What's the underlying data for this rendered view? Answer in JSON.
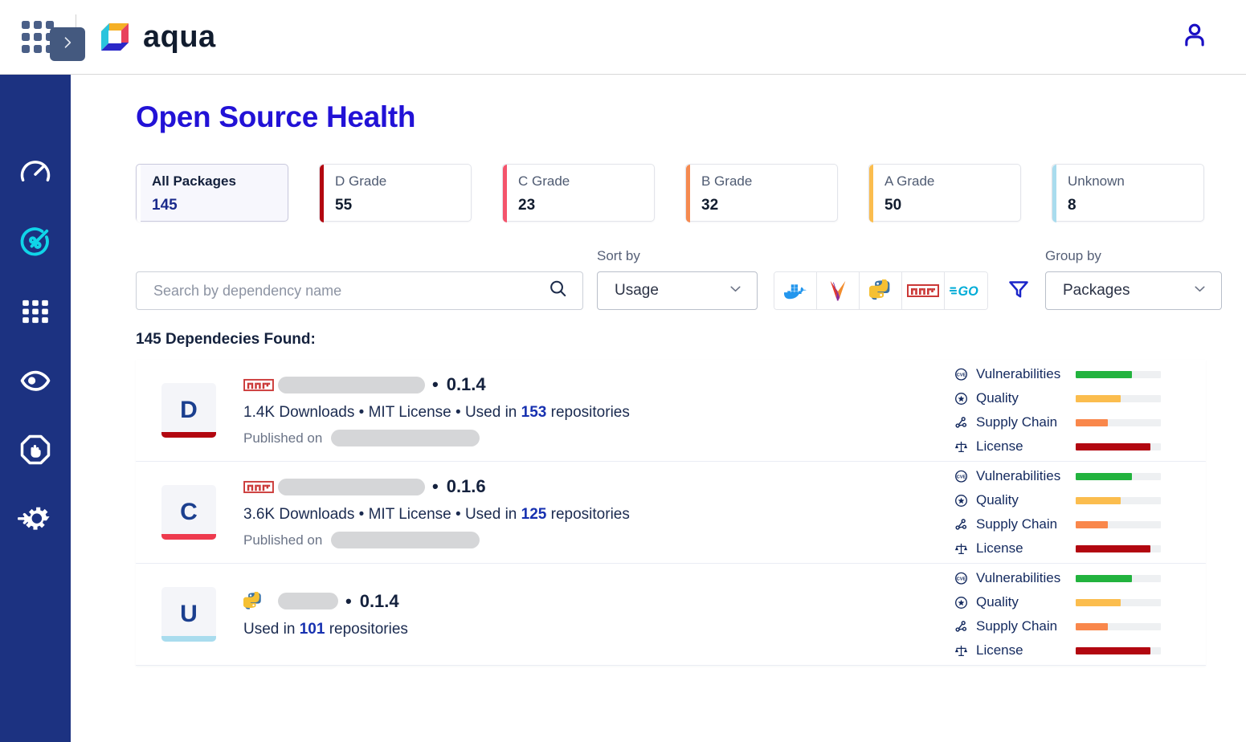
{
  "topbar": {
    "waffle_icon": "apps-grid-icon",
    "brand_name": "aqua",
    "brand_logo_icon": "aqua-logo-icon",
    "user_icon": "user-avatar-icon"
  },
  "sidebar": {
    "toggle_icon": "chevron-right-icon",
    "items": [
      {
        "icon": "dashboard-gauge-icon",
        "active": false
      },
      {
        "icon": "supply-chain-security-icon",
        "active": true
      },
      {
        "icon": "apps-grid-icon",
        "active": false
      },
      {
        "icon": "eye-lens-icon",
        "active": false
      },
      {
        "icon": "stop-hand-octagon-icon",
        "active": false
      },
      {
        "icon": "gear-integration-icon",
        "active": false
      }
    ]
  },
  "page": {
    "title": "Open Source Health"
  },
  "grades": [
    {
      "label": "All Packages",
      "count": "145",
      "accent": "#ffffff",
      "active": true
    },
    {
      "label": "D Grade",
      "count": "55",
      "accent": "#b20710",
      "active": false
    },
    {
      "label": "C Grade",
      "count": "23",
      "accent": "#f4546c",
      "active": false
    },
    {
      "label": "B Grade",
      "count": "32",
      "accent": "#f58a50",
      "active": false
    },
    {
      "label": "A Grade",
      "count": "50",
      "accent": "#fbbd4e",
      "active": false
    },
    {
      "label": "Unknown",
      "count": "8",
      "accent": "#a9dcee",
      "active": false
    }
  ],
  "controls": {
    "search": {
      "placeholder": "Search by dependency name",
      "value": "",
      "icon": "search-icon"
    },
    "sort": {
      "caption": "Sort by",
      "value": "Usage",
      "chevron": "chevron-down-icon"
    },
    "group": {
      "caption": "Group by",
      "value": "Packages",
      "chevron": "chevron-down-icon"
    },
    "tech_filters": [
      {
        "name": "docker-icon",
        "label": "Docker"
      },
      {
        "name": "maven-icon",
        "label": "Maven"
      },
      {
        "name": "python-icon",
        "label": "Python"
      },
      {
        "name": "npm-icon",
        "label": "npm"
      },
      {
        "name": "go-icon",
        "label": "Go"
      }
    ],
    "funnel": {
      "icon": "filter-funnel-icon"
    }
  },
  "list": {
    "found_label": "145 Dependecies Found:",
    "metric_names": [
      "Vulnerabilities",
      "Quality",
      "Supply Chain",
      "License"
    ],
    "metric_icons": [
      "cve-shield-icon",
      "quality-star-icon",
      "supply-chain-nodes-icon",
      "license-scales-icon"
    ],
    "published_label": "Published on",
    "rows": [
      {
        "grade": "D",
        "grade_color": "#b20710",
        "ecosystem": "npm-icon",
        "name_redacted": true,
        "name_width": 183,
        "version": "0.1.4",
        "downloads": "1.4K Downloads",
        "license": "MIT License",
        "used_in_prefix": "Used in",
        "used_in_count": "153",
        "used_in_suffix": "repositories",
        "published_redacted": true,
        "published_width": 185,
        "metrics": [
          {
            "name": "Vulnerabilities",
            "percent": 66,
            "color": "#22b33e"
          },
          {
            "name": "Quality",
            "percent": 53,
            "color": "#fbbd4e"
          },
          {
            "name": "Supply Chain",
            "percent": 38,
            "color": "#f9874b"
          },
          {
            "name": "License",
            "percent": 88,
            "color": "#b20710"
          }
        ]
      },
      {
        "grade": "C",
        "grade_color": "#ee3a4e",
        "ecosystem": "npm-icon",
        "name_redacted": true,
        "name_width": 183,
        "version": "0.1.6",
        "downloads": "3.6K Downloads",
        "license": "MIT License",
        "used_in_prefix": "Used in",
        "used_in_count": "125",
        "used_in_suffix": "repositories",
        "published_redacted": true,
        "published_width": 185,
        "metrics": [
          {
            "name": "Vulnerabilities",
            "percent": 66,
            "color": "#22b33e"
          },
          {
            "name": "Quality",
            "percent": 53,
            "color": "#fbbd4e"
          },
          {
            "name": "Supply Chain",
            "percent": 38,
            "color": "#f9874b"
          },
          {
            "name": "License",
            "percent": 88,
            "color": "#b20710"
          }
        ]
      },
      {
        "grade": "U",
        "grade_color": "#a9dcee",
        "ecosystem": "python-icon",
        "name_redacted": true,
        "name_width": 75,
        "version": "0.1.4",
        "downloads": "",
        "license": "",
        "used_in_prefix": "Used in",
        "used_in_count": "101",
        "used_in_suffix": "repositories",
        "published_redacted": false,
        "published_width": 0,
        "metrics": [
          {
            "name": "Vulnerabilities",
            "percent": 66,
            "color": "#22b33e"
          },
          {
            "name": "Quality",
            "percent": 53,
            "color": "#fbbd4e"
          },
          {
            "name": "Supply Chain",
            "percent": 38,
            "color": "#f9874b"
          },
          {
            "name": "License",
            "percent": 88,
            "color": "#b20710"
          }
        ]
      }
    ]
  },
  "colors": {
    "brand_navy": "#1c3281",
    "title_blue": "#2212d6",
    "accent_cyan": "#10d5e8"
  }
}
